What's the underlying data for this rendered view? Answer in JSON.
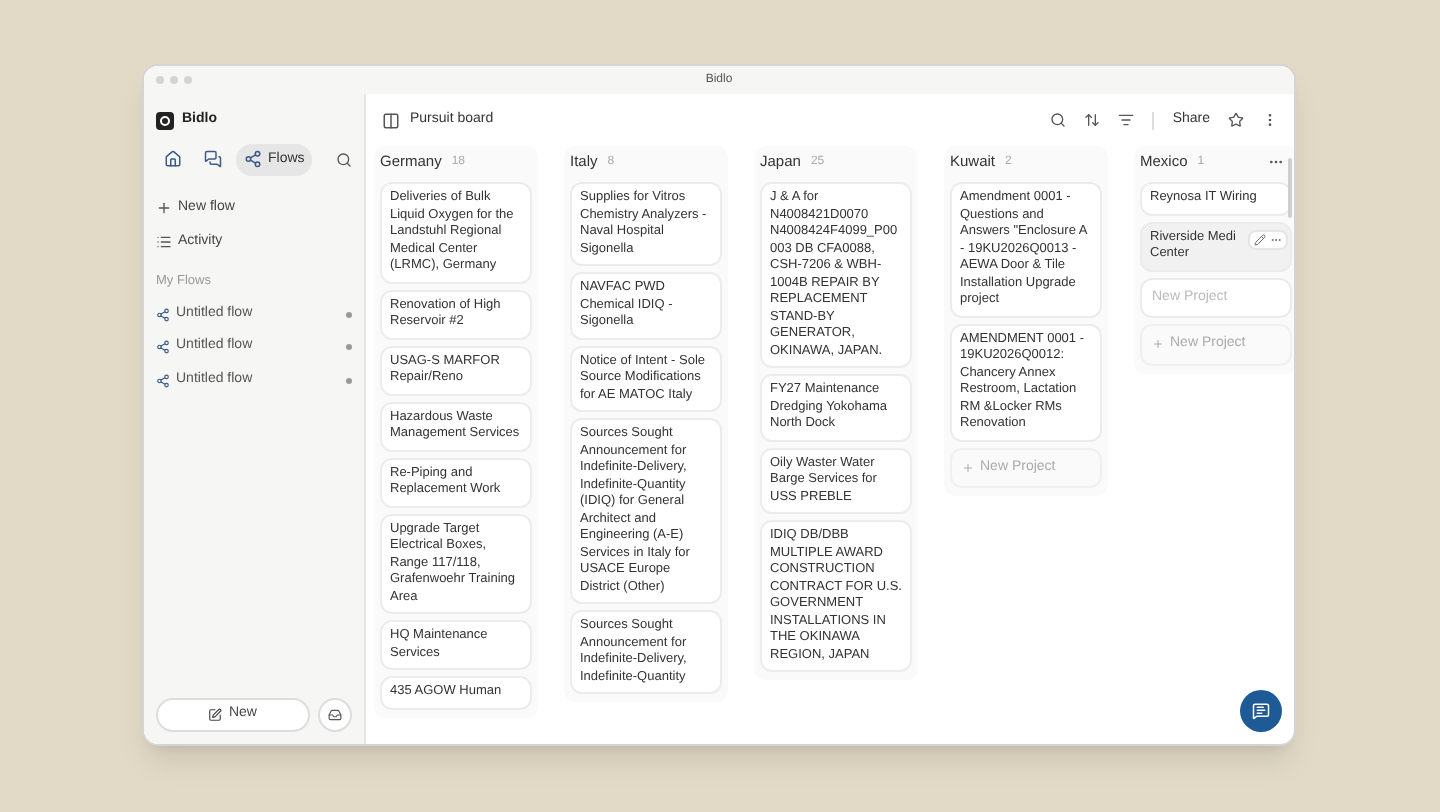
{
  "window": {
    "title": "Bidlo"
  },
  "sidebar": {
    "brand": "Bidlo",
    "tabs": [
      {
        "kind": "home",
        "selected": false
      },
      {
        "kind": "chat",
        "selected": false
      },
      {
        "kind": "flows",
        "label": "Flows",
        "selected": true
      }
    ],
    "actions": [
      {
        "kind": "plus",
        "label": "New flow"
      },
      {
        "kind": "list",
        "label": "Activity"
      }
    ],
    "section": "My Flows",
    "flows": [
      {
        "label": "Untitled flow"
      },
      {
        "label": "Untitled flow"
      },
      {
        "label": "Untitled flow"
      }
    ],
    "new_button": "New"
  },
  "board": {
    "title": "Pursuit board",
    "share": "Share",
    "columns": [
      {
        "name": "Germany",
        "count": "18",
        "cards": [
          {
            "text": "Deliveries of Bulk Liquid Oxygen for the Landstuhl Regional Medical Center (LRMC), Germany"
          },
          {
            "text": "Renovation of High Reservoir #2"
          },
          {
            "text": "USAG-S MARFOR Repair/Reno"
          },
          {
            "text": "Hazardous Waste Management Services"
          },
          {
            "text": "Re-Piping and Replacement Work"
          },
          {
            "text": "Upgrade Target Electrical Boxes, Range 117/118, Grafenwoehr Training Area"
          },
          {
            "text": "HQ Maintenance Services"
          },
          {
            "text": "435 AGOW Human"
          }
        ]
      },
      {
        "name": "Italy",
        "count": "8",
        "cards": [
          {
            "text": "Supplies for Vitros Chemistry Analyzers - Naval Hospital Sigonella"
          },
          {
            "text": "NAVFAC PWD Chemical IDIQ - Sigonella"
          },
          {
            "text": "Notice of Intent - Sole Source Modifications for AE MATOC Italy"
          },
          {
            "text": "Sources Sought Announcement for Indefinite-Delivery, Indefinite-Quantity (IDIQ) for General Architect and Engineering (A-E) Services in Italy for USACE Europe District (Other)"
          },
          {
            "text": "Sources Sought Announcement for Indefinite-Delivery, Indefinite-Quantity"
          }
        ]
      },
      {
        "name": "Japan",
        "count": "25",
        "cards": [
          {
            "text": "J & A for N4008421D0070 N4008424F4099_P00 003 DB CFA0088, CSH-7206 & WBH-1004B REPAIR BY REPLACEMENT STAND-BY GENERATOR, OKINAWA, JAPAN."
          },
          {
            "text": "FY27 Maintenance Dredging Yokohama North Dock"
          },
          {
            "text": "Oily Waster Water Barge Services for USS PREBLE"
          },
          {
            "text": "IDIQ DB/DBB MULTIPLE AWARD CONSTRUCTION CONTRACT FOR U.S. GOVERNMENT INSTALLATIONS IN THE OKINAWA REGION, JAPAN"
          }
        ]
      },
      {
        "name": "Kuwait",
        "count": "2",
        "cards": [
          {
            "text": "Amendment 0001 - Questions and Answers \"Enclosure A - 19KU2026Q0013 - AEWA Door & Tile Installation Upgrade project"
          },
          {
            "text": "AMENDMENT 0001 - 19KU2026Q0012: Chancery Annex Restroom, Lactation RM &Locker RMs Renovation"
          }
        ],
        "new_project": "New Project"
      },
      {
        "name": "Mexico",
        "count": "1",
        "menu": true,
        "cards": [
          {
            "text": "Reynosa IT Wiring",
            "hovered": false
          },
          {
            "text": "Riverside Medi Center",
            "hovered": true
          }
        ],
        "input_placeholder": "New Project",
        "new_project": "New Project"
      }
    ]
  }
}
